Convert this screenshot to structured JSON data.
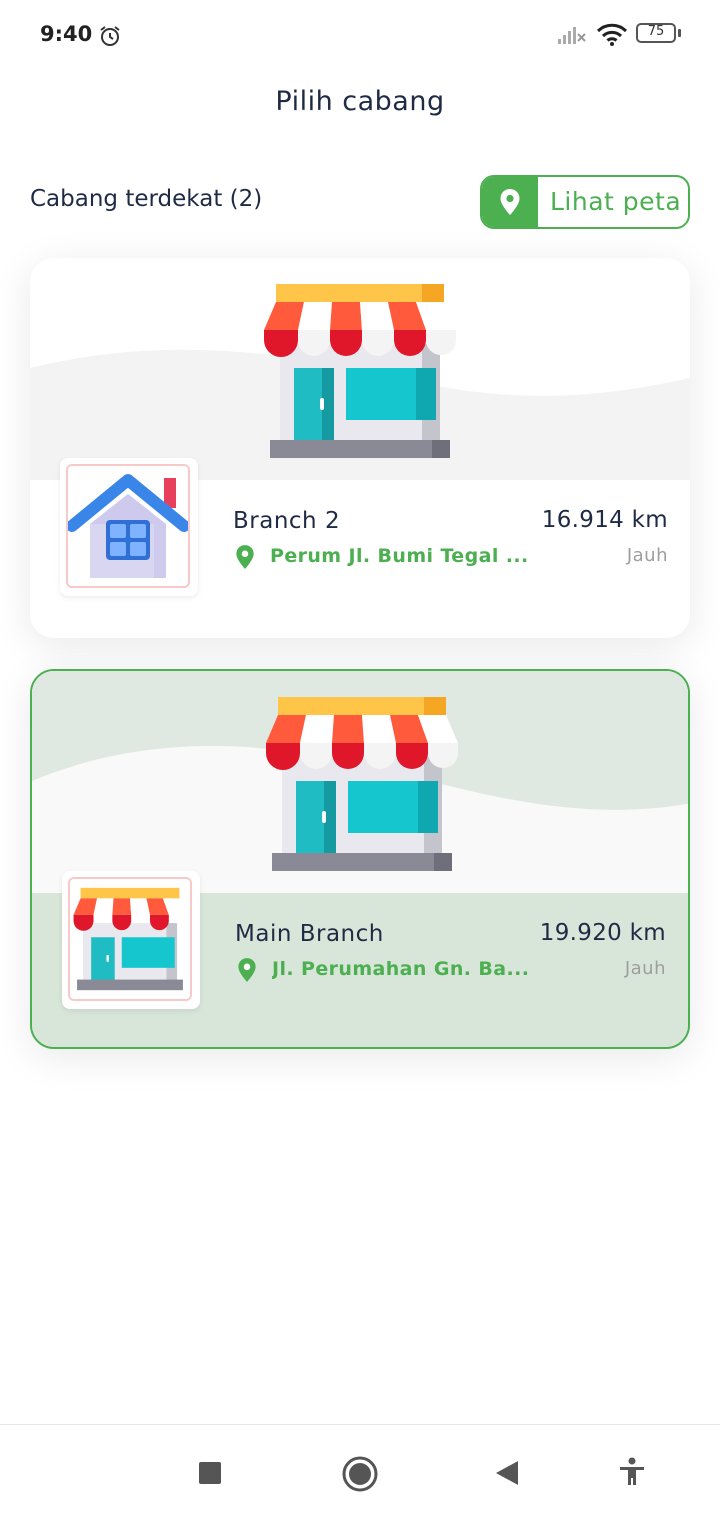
{
  "status_bar": {
    "time": "9:40",
    "battery": "75",
    "icons": [
      "alarm-icon",
      "signal-icon",
      "wifi-icon",
      "battery-icon"
    ]
  },
  "page": {
    "title": "Pilih cabang"
  },
  "nearby": {
    "label": "Cabang terdekat (2)",
    "map_button_label": "Lihat peta",
    "map_button_icon": "location-pin-icon"
  },
  "branches": [
    {
      "name": "Branch 2",
      "address": "Perum Jl. Bumi Tegal ...",
      "distance": "16.914 km",
      "status": "Jauh",
      "thumbnail": "house-icon",
      "selected": false
    },
    {
      "name": "Main Branch",
      "address": "Jl. Perumahan Gn. Ba...",
      "distance": "19.920 km",
      "status": "Jauh",
      "thumbnail": "store-icon",
      "selected": true
    }
  ],
  "colors": {
    "accent": "#4caf50",
    "text_primary": "#1f2a44",
    "text_muted": "#9e9e9e",
    "selected_bg": "#d8e6da"
  },
  "nav_bar": {
    "icons": [
      "recents-icon",
      "home-icon",
      "back-icon",
      "accessibility-icon"
    ]
  }
}
